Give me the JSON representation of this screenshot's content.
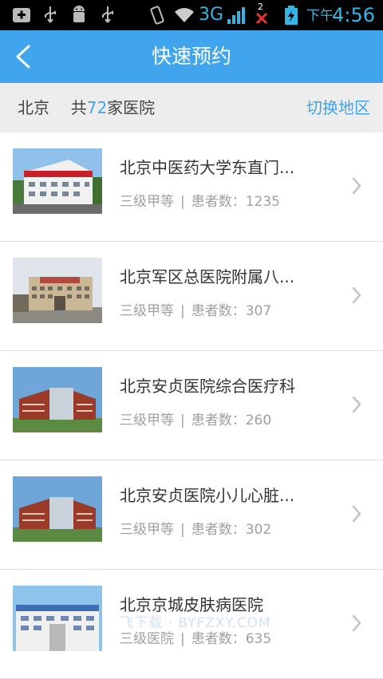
{
  "status_bar": {
    "network": "3G",
    "ampm": "下午",
    "time": "4:56",
    "signal_badge": "2"
  },
  "header": {
    "title": "快速预约",
    "back_icon": "chevron-left-icon"
  },
  "region": {
    "city": "北京",
    "prefix": "共",
    "count": "72",
    "suffix": "家医院",
    "switch_label": "切换地区"
  },
  "hospitals": [
    {
      "name": "北京中医药大学东直门...",
      "level": "三级甲等",
      "sep": "|",
      "patients_label": "患者数：",
      "patients": "1235"
    },
    {
      "name": "北京军区总医院附属八...",
      "level": "三级甲等",
      "sep": "|",
      "patients_label": "患者数：",
      "patients": "307"
    },
    {
      "name": "北京安贞医院综合医疗科",
      "level": "三级甲等",
      "sep": "|",
      "patients_label": "患者数：",
      "patients": "260"
    },
    {
      "name": "北京安贞医院小儿心脏...",
      "level": "三级甲等",
      "sep": "|",
      "patients_label": "患者数：",
      "patients": "302"
    },
    {
      "name": "北京京城皮肤病医院",
      "level": "三级医院",
      "sep": "|",
      "patients_label": "患者数：",
      "patients": "635"
    }
  ],
  "watermark": "飞下载 · BYFZXY.COM",
  "colors": {
    "brand_blue": "#41a5ee",
    "region_bg": "#ededed",
    "status_accent": "#33b5e5"
  }
}
